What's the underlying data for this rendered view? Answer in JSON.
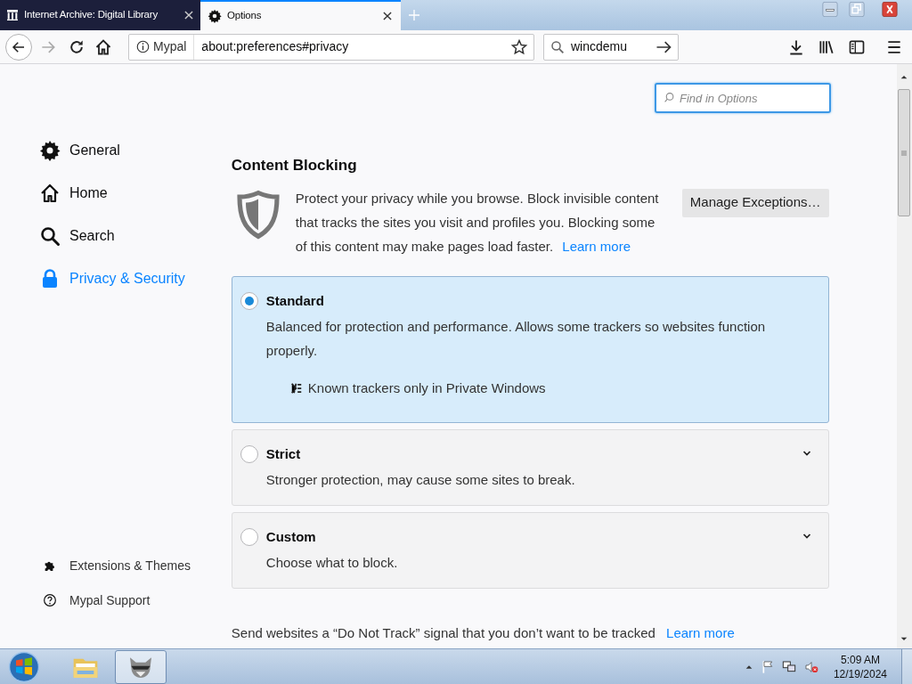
{
  "tabs": [
    {
      "title": "Internet Archive: Digital Library",
      "kind": "archive",
      "selected": false
    },
    {
      "title": "Options",
      "kind": "gear",
      "selected": true
    }
  ],
  "toolbar": {
    "identity": "Mypal",
    "url": "about:preferences#privacy",
    "search_value": "wincdemu"
  },
  "find": {
    "placeholder": "Find in Options"
  },
  "sidebar": {
    "categories": [
      {
        "label": "General",
        "kind": "gear",
        "selected": false
      },
      {
        "label": "Home",
        "kind": "home",
        "selected": false
      },
      {
        "label": "Search",
        "kind": "search",
        "selected": false
      },
      {
        "label": "Privacy & Security",
        "kind": "lock",
        "selected": true
      }
    ],
    "footer": [
      {
        "label": "Extensions & Themes",
        "kind": "puzzle"
      },
      {
        "label": "Mypal Support",
        "kind": "help"
      }
    ]
  },
  "content_blocking": {
    "title": "Content Blocking",
    "description": "Protect your privacy while you browse. Block invisible content that tracks the sites you visit and profiles you. Blocking some of this content may make pages load faster.",
    "learn_more": "Learn more",
    "manage_button": "Manage Exceptions…",
    "options": [
      {
        "label": "Standard",
        "description": "Balanced for protection and performance. Allows some trackers so websites function properly.",
        "selected": true,
        "note": "Known trackers only in Private Windows"
      },
      {
        "label": "Strict",
        "description": "Stronger protection, may cause some sites to break.",
        "selected": false
      },
      {
        "label": "Custom",
        "description": "Choose what to block.",
        "selected": false
      }
    ]
  },
  "dnt": {
    "text": "Send websites a “Do Not Track” signal that you don’t want to be tracked",
    "learn_more": "Learn more"
  },
  "taskbar": {
    "apps": [
      {
        "kind": "folder",
        "selected": false
      },
      {
        "kind": "raccoon",
        "selected": true
      }
    ],
    "time": "5:09 AM",
    "date": "12/19/2024"
  }
}
